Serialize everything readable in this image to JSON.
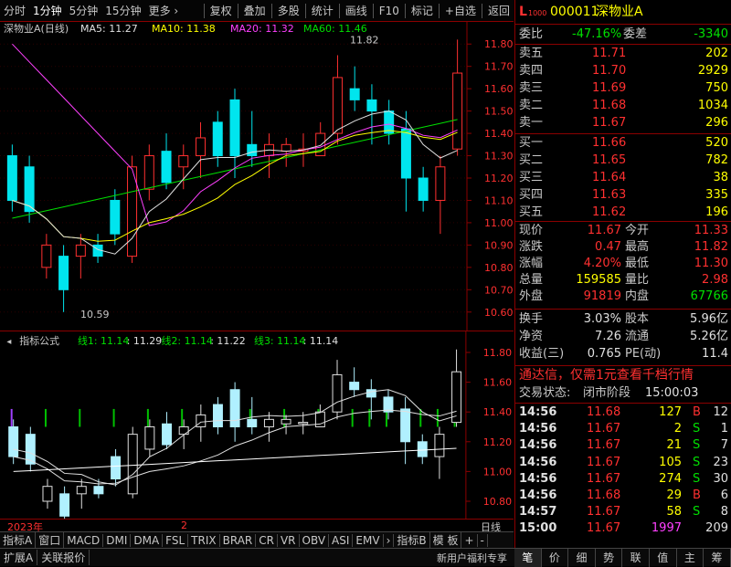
{
  "toolbar": {
    "left": [
      "分时",
      "1分钟",
      "5分钟",
      "15分钟",
      "更多 ›"
    ],
    "right": [
      "复权",
      "叠加",
      "多股",
      "统计",
      "画线",
      "F10",
      "标记",
      "+自选",
      "返回"
    ]
  },
  "chart_header": {
    "stock": "深物业A(日线)",
    "ma5": "MA5: 11.27",
    "ma10": "MA10: 11.38",
    "ma20": "MA20: 11.32",
    "ma60": "MA60: 11.46",
    "high_label": "11.82",
    "low_label": "10.59"
  },
  "price_axis": [
    "11.80",
    "11.70",
    "11.60",
    "11.50",
    "11.40",
    "11.30",
    "11.20",
    "11.10",
    "11.00",
    "10.90",
    "10.80",
    "10.70",
    "10.60"
  ],
  "indicator_header": {
    "name": "指标公式",
    "l1": "线1: 11.14",
    "l1b": ": 11.29",
    "l2": "线2: 11.14",
    "l2b": ": 11.22",
    "l3": "线3: 11.14",
    "l3b": ": 11.14"
  },
  "ind_axis": [
    "11.80",
    "11.60",
    "11.40",
    "11.20",
    "11.00",
    "10.80"
  ],
  "date": {
    "year": "2023年",
    "mark": "2",
    "period": "日线"
  },
  "bottom_tabs": [
    "指标A",
    "窗口",
    "MACD",
    "DMI",
    "DMA",
    "FSL",
    "TRIX",
    "BRAR",
    "CR",
    "VR",
    "OBV",
    "ASI",
    "EMV",
    "›",
    "指标B",
    "模 板",
    "+",
    "-"
  ],
  "status": {
    "left": [
      "扩展A",
      "关联报价"
    ],
    "promo": "新用户福利专享",
    "right": [
      "笔",
      "价",
      "细",
      "势",
      "联",
      "值",
      "主",
      "筹"
    ]
  },
  "quote": {
    "code": "000011",
    "name": "深物业A",
    "tag": "L",
    "level": "1000",
    "weibi_label": "委比",
    "weibi": "-47.16%",
    "weicha_label": "委差",
    "weicha": "-3340",
    "sell": [
      [
        "卖五",
        "11.71",
        "202"
      ],
      [
        "卖四",
        "11.70",
        "2929"
      ],
      [
        "卖三",
        "11.69",
        "750"
      ],
      [
        "卖二",
        "11.68",
        "1034"
      ],
      [
        "卖一",
        "11.67",
        "296"
      ]
    ],
    "buy": [
      [
        "买一",
        "11.66",
        "520"
      ],
      [
        "买二",
        "11.65",
        "782"
      ],
      [
        "买三",
        "11.64",
        "38"
      ],
      [
        "买四",
        "11.63",
        "335"
      ],
      [
        "买五",
        "11.62",
        "196"
      ]
    ],
    "info": [
      [
        "现价",
        "11.67",
        "今开",
        "11.33"
      ],
      [
        "涨跌",
        "0.47",
        "最高",
        "11.82"
      ],
      [
        "涨幅",
        "4.20%",
        "最低",
        "11.30"
      ],
      [
        "总量",
        "159585",
        "量比",
        "2.98"
      ],
      [
        "外盘",
        "91819",
        "内盘",
        "67766"
      ]
    ],
    "info2": [
      [
        "换手",
        "3.03%",
        "股本",
        "5.96亿"
      ],
      [
        "净资",
        "7.26",
        "流通",
        "5.26亿"
      ],
      [
        "收益(三)",
        "0.765",
        "PE(动)",
        "11.4"
      ]
    ],
    "ad": "通达信，仅需1元查看千档行情",
    "trade_state_label": "交易状态:",
    "trade_state": "闭市阶段",
    "trade_time": "15:00:03",
    "ticks": [
      [
        "14:56",
        "11.68",
        "127",
        "B",
        "12"
      ],
      [
        "14:56",
        "11.67",
        "2",
        "S",
        "1"
      ],
      [
        "14:56",
        "11.67",
        "21",
        "S",
        "7"
      ],
      [
        "14:56",
        "11.67",
        "105",
        "S",
        "23"
      ],
      [
        "14:56",
        "11.67",
        "274",
        "S",
        "30"
      ],
      [
        "14:56",
        "11.68",
        "29",
        "B",
        "6"
      ],
      [
        "14:57",
        "11.67",
        "58",
        "S",
        "8"
      ],
      [
        "15:00",
        "11.67",
        "1997",
        "",
        "209"
      ]
    ]
  },
  "chart_data": {
    "type": "candlestick",
    "ylim": [
      10.55,
      11.85
    ],
    "candles": [
      [
        11.3,
        11.35,
        11.05,
        11.1
      ],
      [
        11.25,
        11.3,
        11.0,
        11.05
      ],
      [
        10.8,
        10.95,
        10.75,
        10.9
      ],
      [
        10.85,
        10.9,
        10.6,
        10.7
      ],
      [
        10.85,
        10.95,
        10.75,
        10.9
      ],
      [
        10.9,
        10.95,
        10.82,
        10.85
      ],
      [
        11.1,
        11.15,
        10.9,
        10.95
      ],
      [
        10.85,
        11.3,
        10.82,
        11.25
      ],
      [
        11.15,
        11.35,
        11.1,
        11.3
      ],
      [
        11.32,
        11.4,
        11.15,
        11.18
      ],
      [
        11.25,
        11.35,
        11.15,
        11.3
      ],
      [
        11.3,
        11.45,
        11.2,
        11.38
      ],
      [
        11.45,
        11.5,
        11.25,
        11.3
      ],
      [
        11.55,
        11.6,
        11.2,
        11.3
      ],
      [
        11.35,
        11.5,
        11.25,
        11.3
      ],
      [
        11.3,
        11.4,
        11.2,
        11.35
      ],
      [
        11.32,
        11.38,
        11.25,
        11.35
      ],
      [
        11.32,
        11.4,
        11.25,
        11.33
      ],
      [
        11.3,
        11.45,
        11.3,
        11.4
      ],
      [
        11.4,
        11.75,
        11.35,
        11.65
      ],
      [
        11.6,
        11.7,
        11.5,
        11.55
      ],
      [
        11.55,
        11.62,
        11.35,
        11.5
      ],
      [
        11.5,
        11.55,
        11.35,
        11.4
      ],
      [
        11.42,
        11.5,
        11.05,
        11.2
      ],
      [
        11.2,
        11.25,
        11.05,
        11.1
      ],
      [
        11.1,
        11.3,
        10.95,
        11.25
      ],
      [
        11.33,
        11.82,
        11.3,
        11.67
      ]
    ]
  }
}
